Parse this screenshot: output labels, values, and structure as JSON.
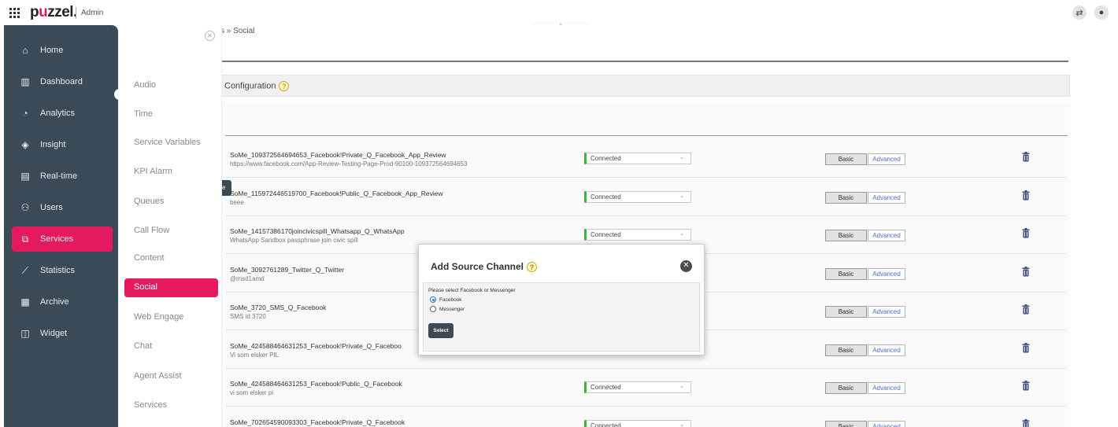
{
  "topbar": {
    "logo": {
      "pre": "p",
      "u": "u",
      "post": "zzel."
    },
    "admin_label": "Admin"
  },
  "breadcrumb": "s » Social",
  "config_title": "Configuration",
  "left_nav": [
    {
      "label": "Home",
      "icon": "home-icon",
      "glyph": "⌂"
    },
    {
      "label": "Dashboard",
      "icon": "dashboard-icon",
      "glyph": "▥"
    },
    {
      "label": "Analytics",
      "icon": "analytics-icon",
      "glyph": "◔"
    },
    {
      "label": "Insight",
      "icon": "insight-icon",
      "glyph": "◈"
    },
    {
      "label": "Real-time",
      "icon": "realtime-icon",
      "glyph": "▤"
    },
    {
      "label": "Users",
      "icon": "users-icon",
      "glyph": "⚇"
    },
    {
      "label": "Services",
      "icon": "services-icon",
      "glyph": "⧉",
      "active": true
    },
    {
      "label": "Statistics",
      "icon": "statistics-icon",
      "glyph": "⟋"
    },
    {
      "label": "Archive",
      "icon": "archive-icon",
      "glyph": "▦"
    },
    {
      "label": "Widget",
      "icon": "widget-icon",
      "glyph": "◫"
    }
  ],
  "sub_nav": [
    {
      "label": "Audio"
    },
    {
      "label": "Time"
    },
    {
      "label": "Service Variables"
    },
    {
      "label": "KPI Alarm"
    },
    {
      "label": "Queues"
    },
    {
      "label": "Call Flow"
    },
    {
      "label": "Content"
    },
    {
      "label": "Social",
      "active": true
    },
    {
      "label": "Web Engage"
    },
    {
      "label": "Chat"
    },
    {
      "label": "Agent Assist"
    },
    {
      "label": "Services"
    }
  ],
  "channels": [
    {
      "name": "SoMe_109372564694653_Facebook!Private_Q_Facebook_App_Review",
      "desc": "https://www.facebook.com/App-Review-Testing-Page-Prod-90100-109372564694653",
      "status": "Connected"
    },
    {
      "name": "SoMe_115972446519700_Facebook!Public_Q_Facebook_App_Review",
      "desc": "beee",
      "status": "Connected"
    },
    {
      "name": "SoMe_14157386170joincivicspill_Whatsapp_Q_WhatsApp",
      "desc": "WhatsApp Sandbox passphrase join civic spill",
      "status": "Connected"
    },
    {
      "name": "SoMe_3092761289_Twitter_Q_Twitter",
      "desc": "@rnsd1amd",
      "status": ""
    },
    {
      "name": "SoMe_3720_SMS_Q_Facebook",
      "desc": "SMS id 3720",
      "status": ""
    },
    {
      "name": "SoMe_424588464631253_Facebook!Private_Q_Faceboo",
      "desc": "Vi som elsker PIL",
      "status": ""
    },
    {
      "name": "SoMe_424588464631253_Facebook!Public_Q_Facebook",
      "desc": "vi som elsker pi",
      "status": "Connected"
    },
    {
      "name": "SoMe_702654590093303_Facebook!Private_Q_Facebook",
      "desc": "",
      "status": "Connected"
    }
  ],
  "buttons": {
    "basic": "Basic",
    "advanced": "Advanced"
  },
  "dialog": {
    "title": "Add Source Channel",
    "prompt": "Please select Facebook or Messenger",
    "options": [
      {
        "label": "Facebook",
        "checked": true
      },
      {
        "label": "Messenger",
        "checked": false
      }
    ],
    "select_label": "Select"
  },
  "colors": {
    "brand": "#e5195f",
    "nav_bg": "#3a4a56",
    "status_ok": "#3cb43c"
  }
}
